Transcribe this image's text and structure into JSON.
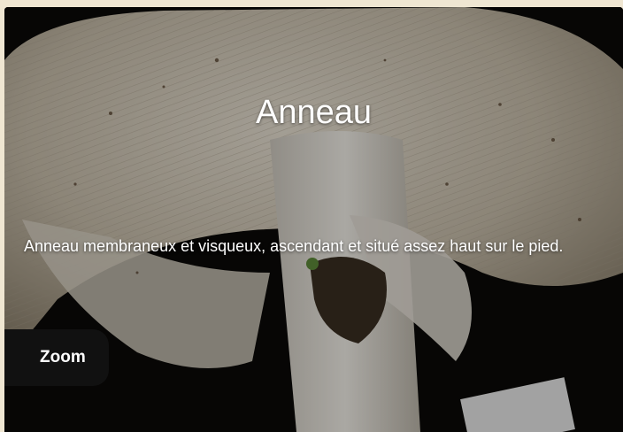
{
  "panel": {
    "title": "Anneau",
    "description": "Anneau membraneux et visqueux, ascendant et situé assez haut sur le pied.",
    "zoom_label": "Zoom"
  },
  "colors": {
    "page_background": "#efe6d2",
    "overlay_text": "#ffffff",
    "button_background": "#111111"
  }
}
